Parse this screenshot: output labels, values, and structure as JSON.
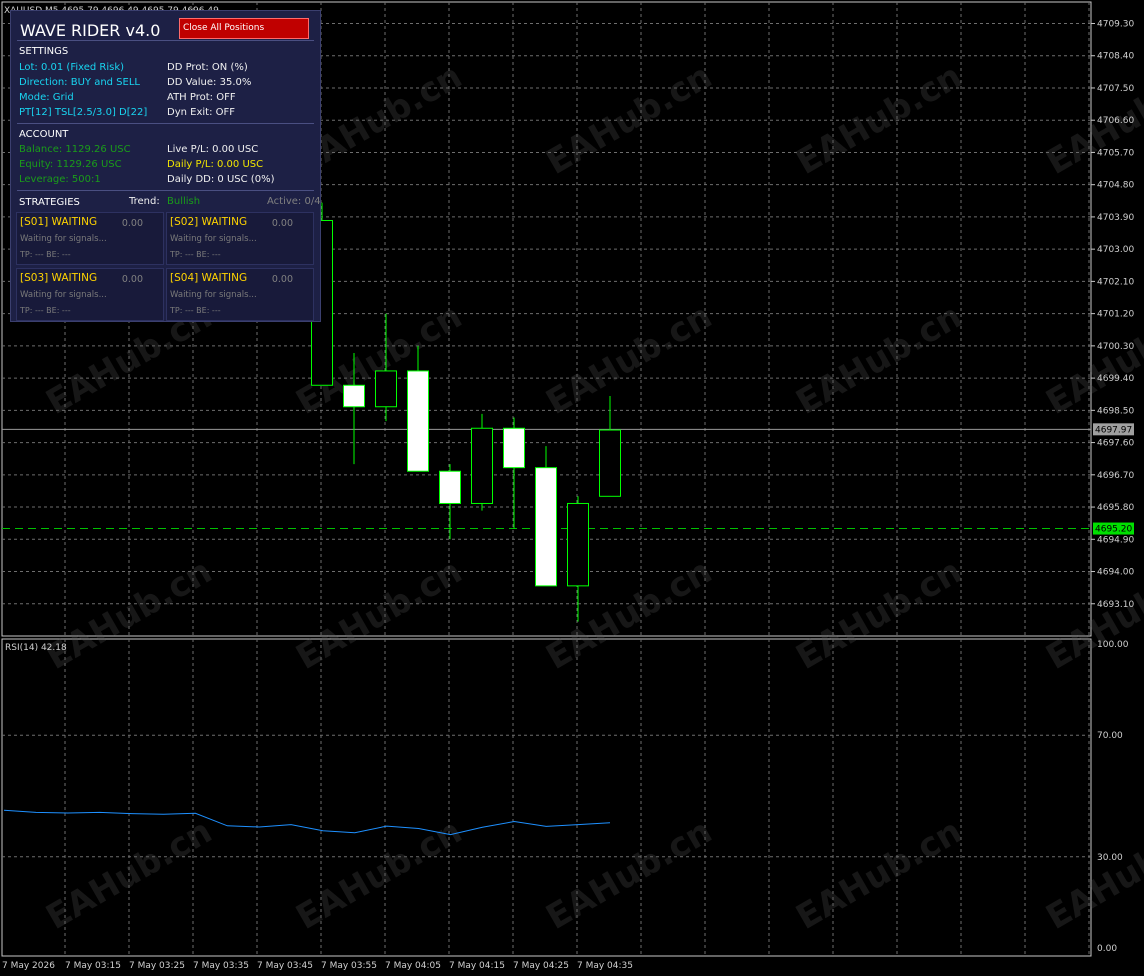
{
  "chart_header": "XAUUSD,M5  4695.79 4696.49 4695.79 4696.49",
  "panel": {
    "title": "WAVE RIDER v4.0",
    "close_button": "Close All Positions",
    "settings_heading": "SETTINGS",
    "settings_left": [
      "Lot: 0.01 (Fixed Risk)",
      "Direction: BUY and SELL",
      "Mode: Grid",
      "PT[12] TSL[2.5/3.0] D[22]"
    ],
    "settings_right": [
      "DD Prot: ON (%)",
      "DD Value: 35.0%",
      "ATH Prot: OFF",
      "Dyn Exit: OFF"
    ],
    "account_heading": "ACCOUNT",
    "account_left": [
      "Balance: 1129.26 USC",
      "Equity: 1129.26 USC",
      "Leverage: 500:1"
    ],
    "account_right": [
      "Live P/L: 0.00 USC",
      "Daily P/L: 0.00 USC",
      "Daily DD: 0 USC (0%)"
    ],
    "strategies_heading": "STRATEGIES",
    "trend_label": "Trend:",
    "trend_value": "Bullish",
    "active": "Active: 0/4",
    "strategies": [
      {
        "title": "[S01] WAITING",
        "value": "0.00",
        "status": "Waiting for signals...",
        "tp": "TP: --- BE: ---"
      },
      {
        "title": "[S02] WAITING",
        "value": "0.00",
        "status": "Waiting for signals...",
        "tp": "TP: --- BE: ---"
      },
      {
        "title": "[S03] WAITING",
        "value": "0.00",
        "status": "Waiting for signals...",
        "tp": "TP: --- BE: ---"
      },
      {
        "title": "[S04] WAITING",
        "value": "0.00",
        "status": "Waiting for signals...",
        "tp": "TP: --- BE: ---"
      }
    ]
  },
  "rsi_label": "RSI(14) 42.18",
  "watermark": "EAHub.cn",
  "colors": {
    "bull": "#00ff00",
    "bear_body": "#ffffff",
    "bid_line": "#00c000",
    "rsi_line": "#1e90ff",
    "panel_bg": "#1d2045",
    "close_btn": "#c00000"
  },
  "chart_data": [
    {
      "type": "candlestick",
      "y_ticks": [
        "4709.30",
        "4708.40",
        "4707.50",
        "4706.60",
        "4705.70",
        "4704.80",
        "4703.90",
        "4703.00",
        "4702.10",
        "4701.20",
        "4700.30",
        "4699.40",
        "4698.50",
        "4697.60",
        "4696.70",
        "4695.80",
        "4694.90",
        "4694.00",
        "4693.10"
      ],
      "ylim": [
        4692.2,
        4709.9
      ],
      "ask_price": "4697.97",
      "bid_price": "4695.20",
      "x_labels": [
        "7 May 2026",
        "7 May 03:15",
        "7 May 03:25",
        "7 May 03:35",
        "7 May 03:45",
        "7 May 03:55",
        "7 May 04:05",
        "7 May 04:15",
        "7 May 04:25",
        "7 May 04:35"
      ],
      "candles": [
        {
          "o": 4699.2,
          "h": 4704.3,
          "l": 4699.2,
          "c": 4703.8
        },
        {
          "o": 4699.2,
          "h": 4700.1,
          "l": 4697.0,
          "c": 4698.6
        },
        {
          "o": 4698.6,
          "h": 4701.2,
          "l": 4698.2,
          "c": 4699.6
        },
        {
          "o": 4699.6,
          "h": 4700.3,
          "l": 4697.0,
          "c": 4696.8
        },
        {
          "o": 4696.8,
          "h": 4697.0,
          "l": 4694.9,
          "c": 4695.9
        },
        {
          "o": 4695.9,
          "h": 4698.4,
          "l": 4695.7,
          "c": 4698.0
        },
        {
          "o": 4698.0,
          "h": 4698.3,
          "l": 4695.2,
          "c": 4696.9
        },
        {
          "o": 4696.9,
          "h": 4697.5,
          "l": 4693.6,
          "c": 4693.6
        },
        {
          "o": 4693.6,
          "h": 4696.1,
          "l": 4692.6,
          "c": 4695.9
        },
        {
          "o": 4696.1,
          "h": 4698.9,
          "l": 4696.1,
          "c": 4697.95
        }
      ]
    },
    {
      "type": "line",
      "name": "RSI(14)",
      "y_ticks": [
        "100.00",
        "70.00",
        "30.00",
        "0.00"
      ],
      "ylim": [
        0,
        100
      ],
      "values": [
        45.3,
        44.6,
        44.4,
        44.6,
        44.2,
        44.0,
        44.3,
        40.2,
        39.8,
        40.6,
        38.6,
        37.9,
        40.1,
        39.3,
        37.3,
        39.7,
        41.6,
        40.0,
        40.6,
        41.2
      ]
    }
  ]
}
